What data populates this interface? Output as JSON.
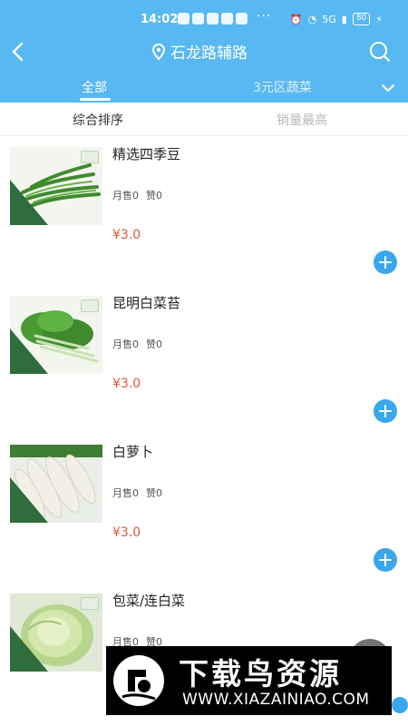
{
  "status_bar": {
    "time": "14:02",
    "dots": "···",
    "signal": "5G",
    "battery": "80"
  },
  "header": {
    "location": "石龙路辅路",
    "icons": [
      "back-arrow-icon",
      "location-pin-icon",
      "search-icon",
      "chevron-down-icon"
    ]
  },
  "tabs": [
    {
      "label": "全部",
      "active": true
    },
    {
      "label": "3元区蔬菜",
      "active": false
    }
  ],
  "sort": {
    "composite": "综合排序",
    "sales": "销量最高"
  },
  "products": [
    {
      "name": "精选四季豆",
      "sales": "月售0",
      "likes": "赞0",
      "price": "¥3.0",
      "image": "green-beans"
    },
    {
      "name": "昆明白菜苔",
      "sales": "月售0",
      "likes": "赞0",
      "price": "¥3.0",
      "image": "bok-choy"
    },
    {
      "name": "白萝卜",
      "sales": "月售0",
      "likes": "赞0",
      "price": "¥3.0",
      "image": "white-radish"
    },
    {
      "name": "包菜/连白菜",
      "sales": "月售0",
      "likes": "赞0",
      "price": "",
      "image": "cabbage"
    }
  ],
  "watermark": {
    "title": "下载鸟资源",
    "url": "WWW.XIAZAINIAO.COM"
  },
  "colors": {
    "header_blue": "#58b8f1",
    "price_red": "#e5563b",
    "add_button_blue": "#3aa7ea"
  }
}
